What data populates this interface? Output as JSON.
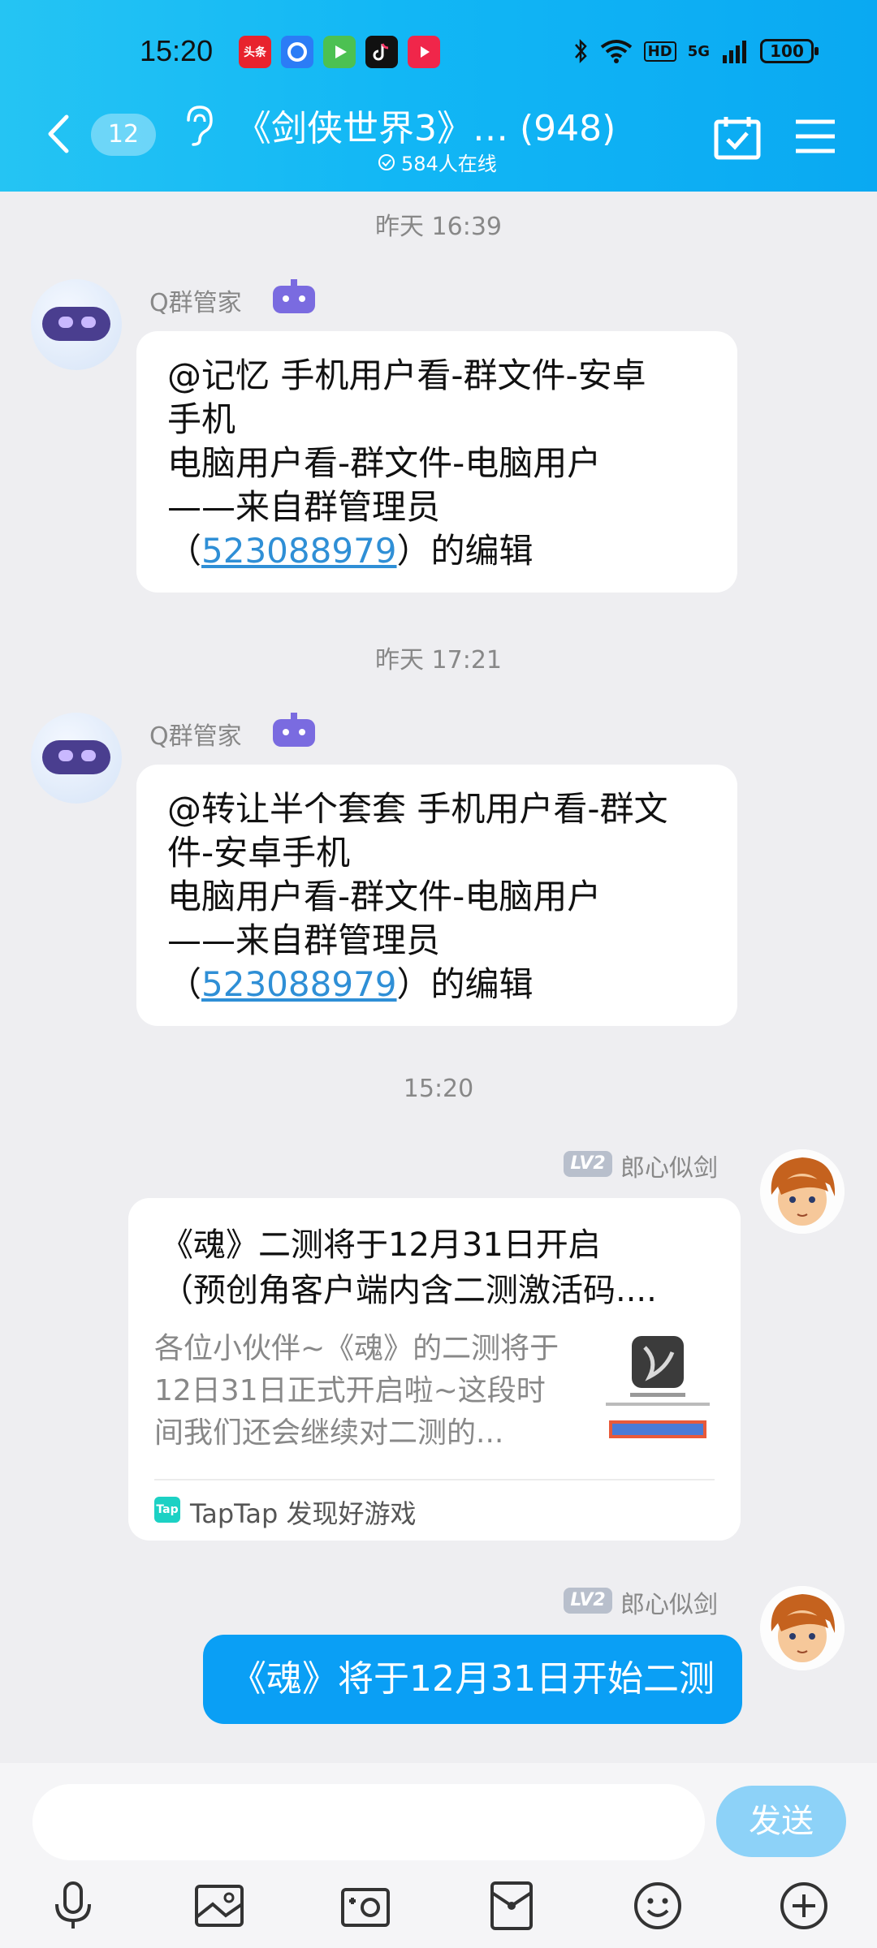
{
  "status": {
    "time": "15:20",
    "battery": "100",
    "app_icons": [
      {
        "name": "toutiao-icon",
        "label": "头条",
        "color": "#e8232d"
      },
      {
        "name": "browser-icon",
        "label": "",
        "color": "#2b7cf6"
      },
      {
        "name": "video-icon",
        "label": "",
        "color": "#4cc152"
      },
      {
        "name": "douyin-icon",
        "label": "",
        "color": "#111111"
      },
      {
        "name": "youtube-icon",
        "label": "",
        "color": "#f0264a"
      }
    ],
    "hd": "HD",
    "signal": "5G"
  },
  "header": {
    "unread_count": "12",
    "title": "《剑侠世界3》… (948)",
    "online": "584人在线"
  },
  "messages": {
    "ts1": "昨天 16:39",
    "ts2": "昨天 17:21",
    "ts3": "15:20",
    "bot_name": "Q群管家",
    "m1": {
      "line1": "@记忆 手机用户看-群文件-安卓",
      "line2": "手机",
      "line3": "电脑用户看-群文件-电脑用户",
      "line4": "——来自群管理员",
      "paren_open": "（",
      "link": "523088979",
      "paren_close": "）的编辑"
    },
    "m2": {
      "line1": "@转让半个套套 手机用户看-群文",
      "line2": "件-安卓手机",
      "line3": "电脑用户看-群文件-电脑用户",
      "line4": "——来自群管理员",
      "paren_open": "（",
      "link": "523088979",
      "paren_close": "）的编辑"
    },
    "user_level": "LV2",
    "user_name": "郎心似剑",
    "card": {
      "title1": "《魂》二测将于12月31日开启",
      "title2": "（预创角客户端内含二测激活码....",
      "desc1": "各位小伙伴~《魂》的二测将于",
      "desc2": "12日31日正式开启啦~这段时",
      "desc3": "间我们还会继续对二测的...",
      "source": "TapTap 发现好游戏",
      "tap_logo": "Tap"
    },
    "m4": "《魂》将于12月31日开始二测"
  },
  "input": {
    "placeholder": "",
    "send_label": "发送"
  }
}
